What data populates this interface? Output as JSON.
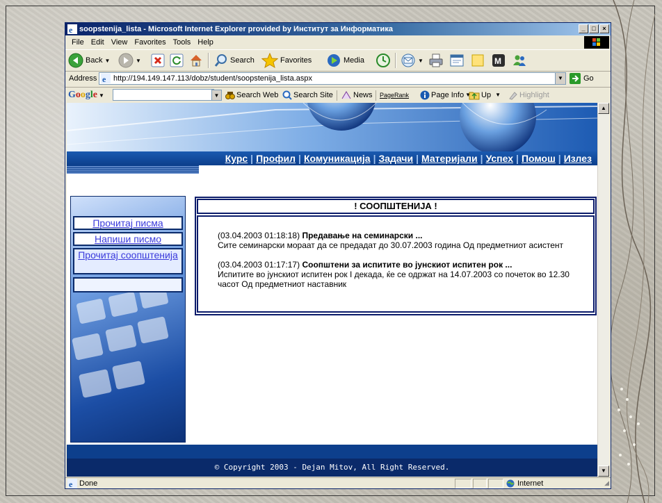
{
  "window": {
    "title": "soopstenija_lista - Microsoft Internet Explorer provided by Институт за Информатика",
    "controls": {
      "minimize": "_",
      "maximize": "□",
      "close": "×"
    }
  },
  "menu": [
    "File",
    "Edit",
    "View",
    "Favorites",
    "Tools",
    "Help"
  ],
  "toolbar": {
    "back_label": "Back",
    "search_label": "Search",
    "favorites_label": "Favorites",
    "media_label": "Media"
  },
  "address": {
    "label": "Address",
    "url": "http://194.149.147.113/dobz/student/soopstenija_lista.aspx",
    "go_label": "Go"
  },
  "google_toolbar": {
    "logo": {
      "g1": "G",
      "o1": "o",
      "o2": "o",
      "g2": "g",
      "l": "l",
      "e": "e"
    },
    "search_web": "Search Web",
    "search_site": "Search Site",
    "news": "News",
    "pagerank": "PageRank",
    "page_info": "Page Info",
    "up": "Up",
    "highlight": "Highlight"
  },
  "site_nav": [
    "Курс",
    "Профил",
    "Комуникација",
    "Задачи",
    "Материјали",
    "Успех",
    "Помош",
    "Излез"
  ],
  "sidebar": {
    "links": [
      "Прочитај писма",
      "Напиши писмо",
      "Прочитај соопштенија"
    ]
  },
  "panel": {
    "title": "! СООПШТЕНИЈА !",
    "notices": [
      {
        "timestamp": "(03.04.2003 01:18:18)",
        "title": "Предавање на семинарски ...",
        "body": "Сите семинарски мораат да се предадат до 30.07.2003 година Од предметниот асистент"
      },
      {
        "timestamp": "(03.04.2003 01:17:17)",
        "title": "Соопштени за испитите во јунскиот испитен рок ...",
        "body": "Испитите во јунскиот испитен рок I декада, ќе се одржат на 14.07.2003 со почеток во 12.30 часот Од предметниот наставник"
      }
    ]
  },
  "footer": "© Copyright 2003 - Dejan Mitov, All Right Reserved.",
  "status": {
    "text": "Done",
    "zone": "Internet"
  },
  "colors": {
    "navbar": "#0d3f8c",
    "footer": "#0a2a6a",
    "panel_border": "#0a1a6a",
    "link": "#3a3adb"
  }
}
